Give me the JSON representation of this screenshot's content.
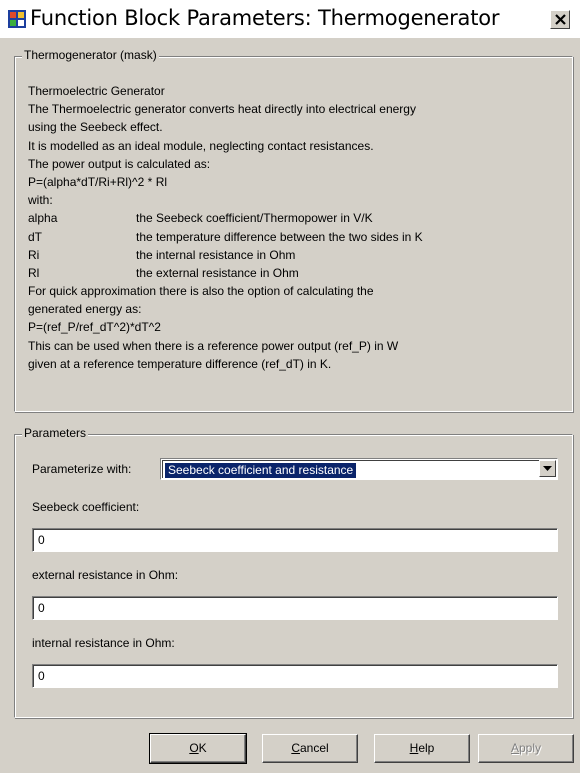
{
  "window": {
    "title": "Function Block Parameters: Thermogenerator",
    "icon": "simulink-block-icon",
    "close": "close-icon"
  },
  "mask_group": {
    "legend": "Thermogenerator (mask)",
    "lines": [
      "Thermoelectric Generator",
      "The Thermoelectric generator converts heat directly into electrical energy",
      "using the Seebeck effect.",
      "It is modelled as an ideal module, neglecting contact resistances.",
      "The power output is calculated as:",
      "P=(alpha*dT/Ri+Rl)^2 * Rl",
      "with:"
    ],
    "definitions": [
      {
        "term": "alpha",
        "desc": "the Seebeck coefficient/Thermopower in V/K"
      },
      {
        "term": "dT",
        "desc": "the temperature difference between the two sides in K"
      },
      {
        "term": "Ri",
        "desc": "the internal resistance in Ohm"
      },
      {
        "term": "Rl",
        "desc": "the external resistance in Ohm"
      }
    ],
    "lines_after": [
      "For quick approximation there is also the option of calculating the",
      "generated energy as:",
      "P=(ref_P/ref_dT^2)*dT^2",
      "This can be used when there is a reference power output (ref_P) in W",
      "given at a reference temperature difference (ref_dT) in K."
    ]
  },
  "params_group": {
    "legend": "Parameters",
    "parameterize_label": "Parameterize with:",
    "parameterize_value": "Seebeck coefficient and resistance",
    "fields": [
      {
        "label": "Seebeck coefficient:",
        "value": "0"
      },
      {
        "label": "external resistance in Ohm:",
        "value": "0"
      },
      {
        "label": "internal resistance in Ohm:",
        "value": "0"
      }
    ]
  },
  "buttons": {
    "ok": {
      "mnemonic": "O",
      "rest": "K"
    },
    "cancel": {
      "mnemonic": "C",
      "rest": "ancel"
    },
    "help": {
      "mnemonic": "H",
      "rest": "elp"
    },
    "apply": {
      "mnemonic": "A",
      "rest": "pply"
    }
  }
}
